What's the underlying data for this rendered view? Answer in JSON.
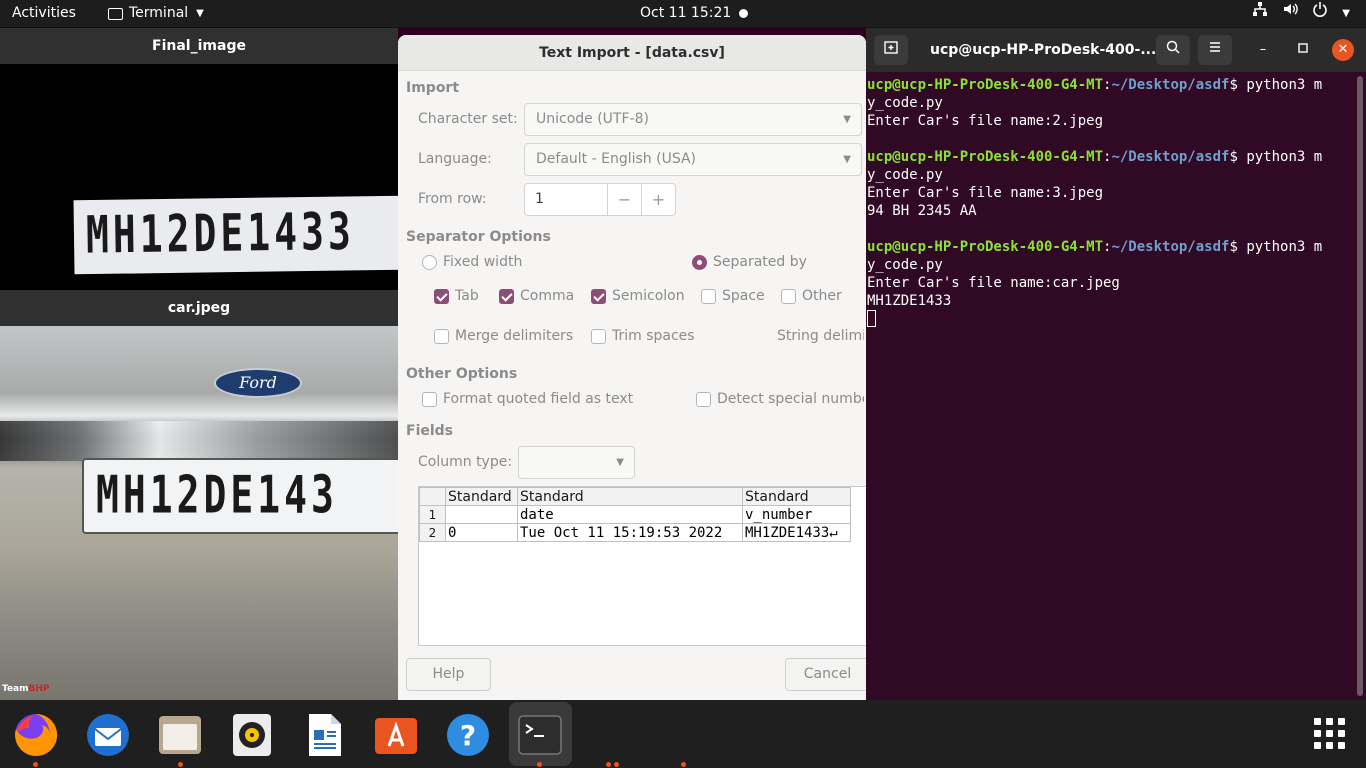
{
  "topbar": {
    "activities": "Activities",
    "app_name": "Terminal",
    "clock": "Oct 11  15:21"
  },
  "final_window": {
    "title": "Final_image",
    "plate_text": "MH12DE1433"
  },
  "car_window": {
    "title": "car.jpeg",
    "plate_text": "MH12DE143",
    "logo_text": "Ford",
    "watermark_prefix": "Team",
    "watermark_brand": "BHP"
  },
  "dialog": {
    "title": "Text Import - [data.csv]",
    "import_section": "Import",
    "charset_label": "Character set:",
    "charset_value": "Unicode (UTF-8)",
    "language_label": "Language:",
    "language_value": "Default - English (USA)",
    "from_row_label": "From row:",
    "from_row_value": "1",
    "separator_section": "Separator Options",
    "fixed_width": "Fixed width",
    "separated_by": "Separated by",
    "tab": "Tab",
    "comma": "Comma",
    "semicolon": "Semicolon",
    "space": "Space",
    "other": "Other",
    "merge_delimiters": "Merge delimiters",
    "trim_spaces": "Trim spaces",
    "string_delimiter": "String delimiter:",
    "other_options_section": "Other Options",
    "format_quoted": "Format quoted field as text",
    "detect_special": "Detect special numbers",
    "fields_section": "Fields",
    "column_type_label": "Column type:",
    "preview": {
      "headers": [
        "Standard",
        "Standard",
        "Standard"
      ],
      "rows": [
        {
          "num": "1",
          "cells": [
            "",
            "date",
            "v_number"
          ]
        },
        {
          "num": "2",
          "cells": [
            "0",
            "Tue Oct 11 15:19:53 2022",
            "MH1ZDE1433↵"
          ]
        }
      ]
    },
    "help_button": "Help",
    "cancel_button": "Cancel"
  },
  "terminal": {
    "title": "ucp@ucp-HP-ProDesk-400-...",
    "prompt_user": "ucp@ucp-HP-ProDesk-400-G4-MT",
    "prompt_path": "~/Desktop/asdf",
    "lines": {
      "cmd": "$ python3 m",
      "cmd_wrap": "y_code.py",
      "input1": "Enter Car's file name:2.jpeg",
      "input2": "Enter Car's file name:3.jpeg",
      "output2": "94 BH 2345 AA",
      "input3": "Enter Car's file name:car.jpeg",
      "output3": "MH1ZDE1433"
    }
  },
  "dock": {
    "items": [
      "firefox-icon",
      "thunderbird-icon",
      "files-icon",
      "rhythmbox-icon",
      "writer-icon",
      "software-icon",
      "help-icon",
      "terminal-icon",
      "show-apps-icon"
    ]
  },
  "colors": {
    "accent": "#e95420",
    "checkbox": "#8c4d79",
    "terminal_bg": "#300a24",
    "prompt_user": "#8ae234",
    "prompt_path": "#729fcf"
  }
}
